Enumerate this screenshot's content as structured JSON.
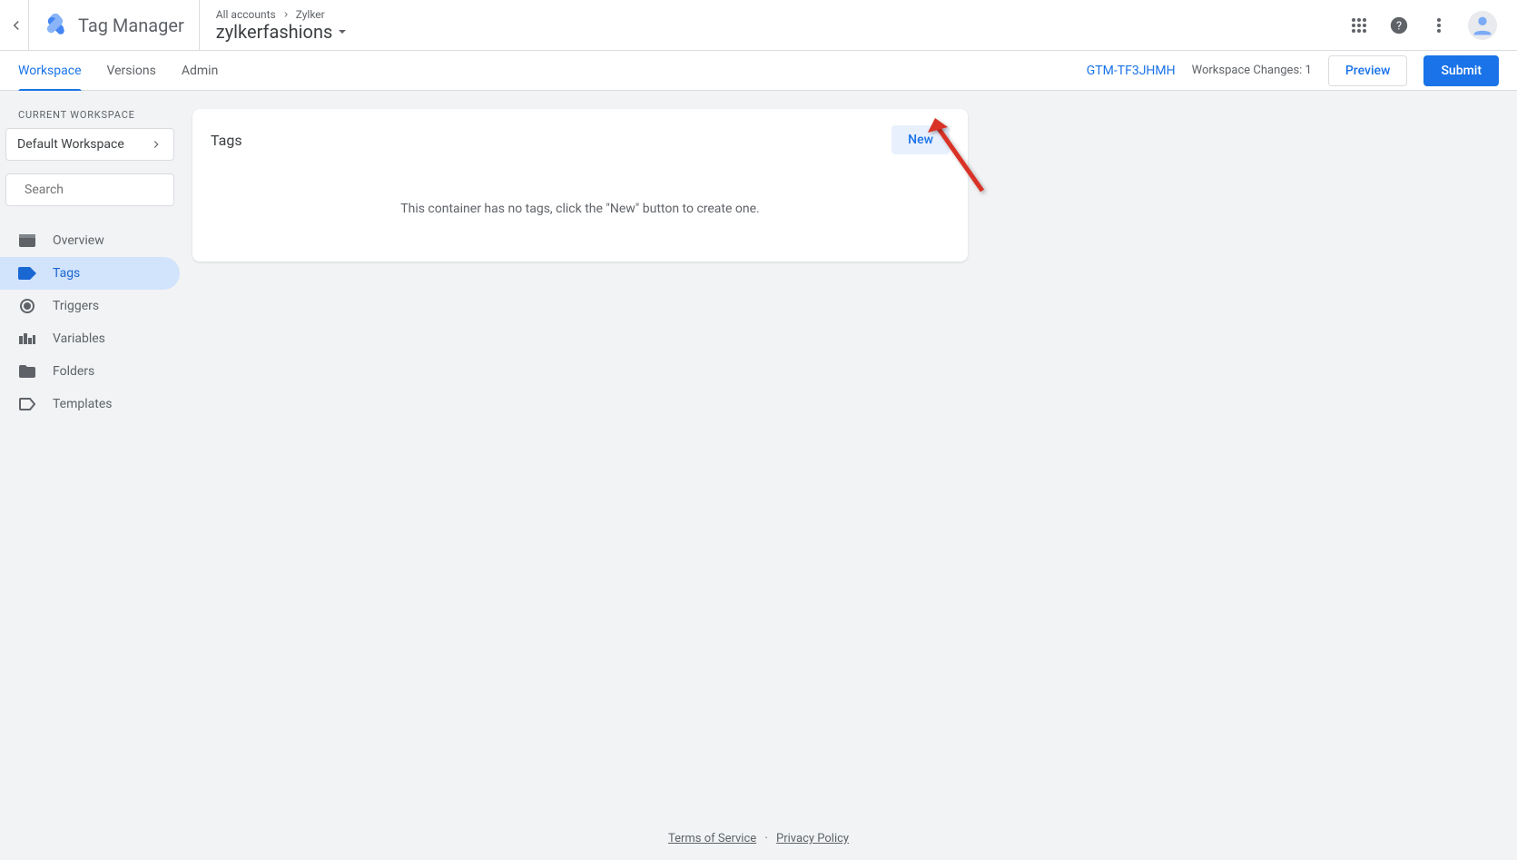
{
  "header": {
    "app_title": "Tag Manager",
    "breadcrumb_root": "All accounts",
    "breadcrumb_account": "Zylker",
    "container_name": "zylkerfashions"
  },
  "subnav": {
    "tabs": [
      "Workspace",
      "Versions",
      "Admin"
    ],
    "container_id": "GTM-TF3JHMH",
    "changes_label": "Workspace Changes:",
    "changes_count": "1",
    "preview_label": "Preview",
    "submit_label": "Submit"
  },
  "sidebar": {
    "section_label": "CURRENT WORKSPACE",
    "workspace_name": "Default Workspace",
    "search_placeholder": "Search",
    "items": [
      {
        "label": "Overview"
      },
      {
        "label": "Tags"
      },
      {
        "label": "Triggers"
      },
      {
        "label": "Variables"
      },
      {
        "label": "Folders"
      },
      {
        "label": "Templates"
      }
    ]
  },
  "card": {
    "title": "Tags",
    "new_label": "New",
    "empty_message": "This container has no tags, click the \"New\" button to create one."
  },
  "footer": {
    "terms": "Terms of Service",
    "privacy": "Privacy Policy"
  }
}
